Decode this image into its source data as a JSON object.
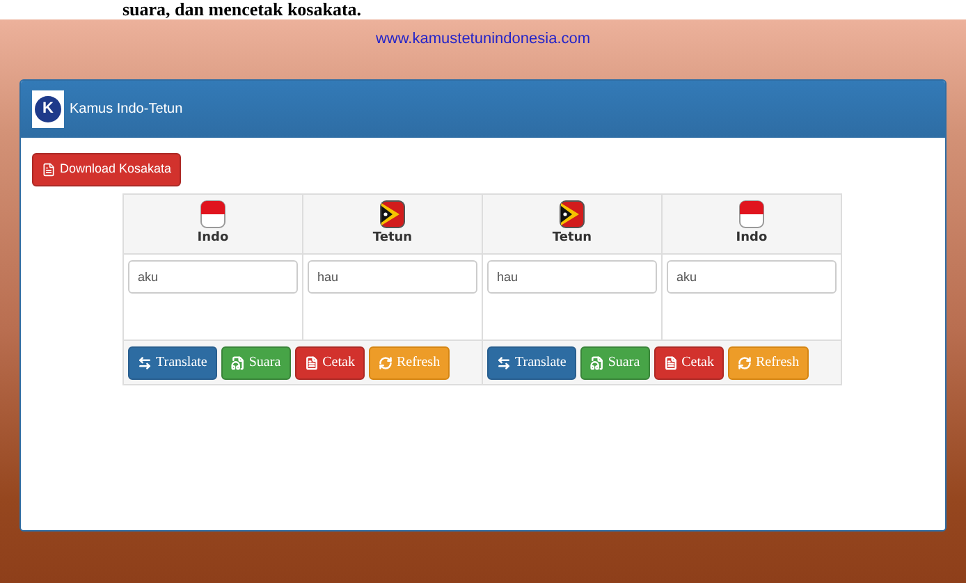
{
  "document_text": "suara, dan mencetak kosakata.",
  "site_url": "www.kamustetunindonesia.com",
  "panel": {
    "logo_letter": "K",
    "title": "Kamus Indo-Tetun"
  },
  "download_button": "Download Kosakata",
  "translators": [
    {
      "columns": [
        {
          "kind": "indonesia",
          "label": "Indo",
          "value": "aku"
        },
        {
          "kind": "timor",
          "label": "Tetun",
          "value": "hau"
        }
      ],
      "buttons": [
        {
          "kind": "translate",
          "label": "Translate"
        },
        {
          "kind": "sound",
          "label": "Suara"
        },
        {
          "kind": "print",
          "label": "Cetak"
        },
        {
          "kind": "refresh",
          "label": "Refresh"
        }
      ]
    },
    {
      "columns": [
        {
          "kind": "timor",
          "label": "Tetun",
          "value": "hau"
        },
        {
          "kind": "indonesia",
          "label": "Indo",
          "value": "aku"
        }
      ],
      "buttons": [
        {
          "kind": "translate",
          "label": "Translate"
        },
        {
          "kind": "sound",
          "label": "Suara"
        },
        {
          "kind": "print",
          "label": "Cetak"
        },
        {
          "kind": "refresh",
          "label": "Refresh"
        }
      ]
    }
  ]
}
